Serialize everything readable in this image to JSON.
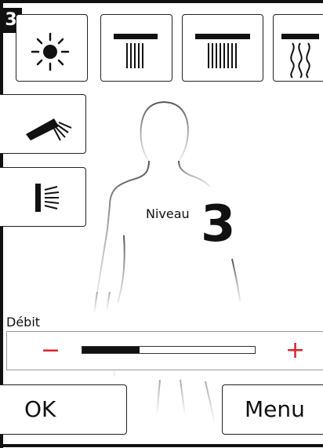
{
  "badge": "3",
  "spray_modes": [
    {
      "icon": "sun-icon"
    },
    {
      "icon": "shower-narrow-icon"
    },
    {
      "icon": "shower-wide-icon"
    },
    {
      "icon": "shower-massage-icon"
    },
    {
      "icon": "hand-shower-icon"
    },
    {
      "icon": "side-jet-icon"
    }
  ],
  "level": {
    "label": "Niveau",
    "value": "3"
  },
  "flow": {
    "label": "Débit",
    "minus": "−",
    "plus": "+",
    "fraction": 0.33
  },
  "buttons": {
    "ok": "OK",
    "menu": "Menu"
  },
  "colors": {
    "accent": "#d8232a",
    "fill": "#111111"
  }
}
